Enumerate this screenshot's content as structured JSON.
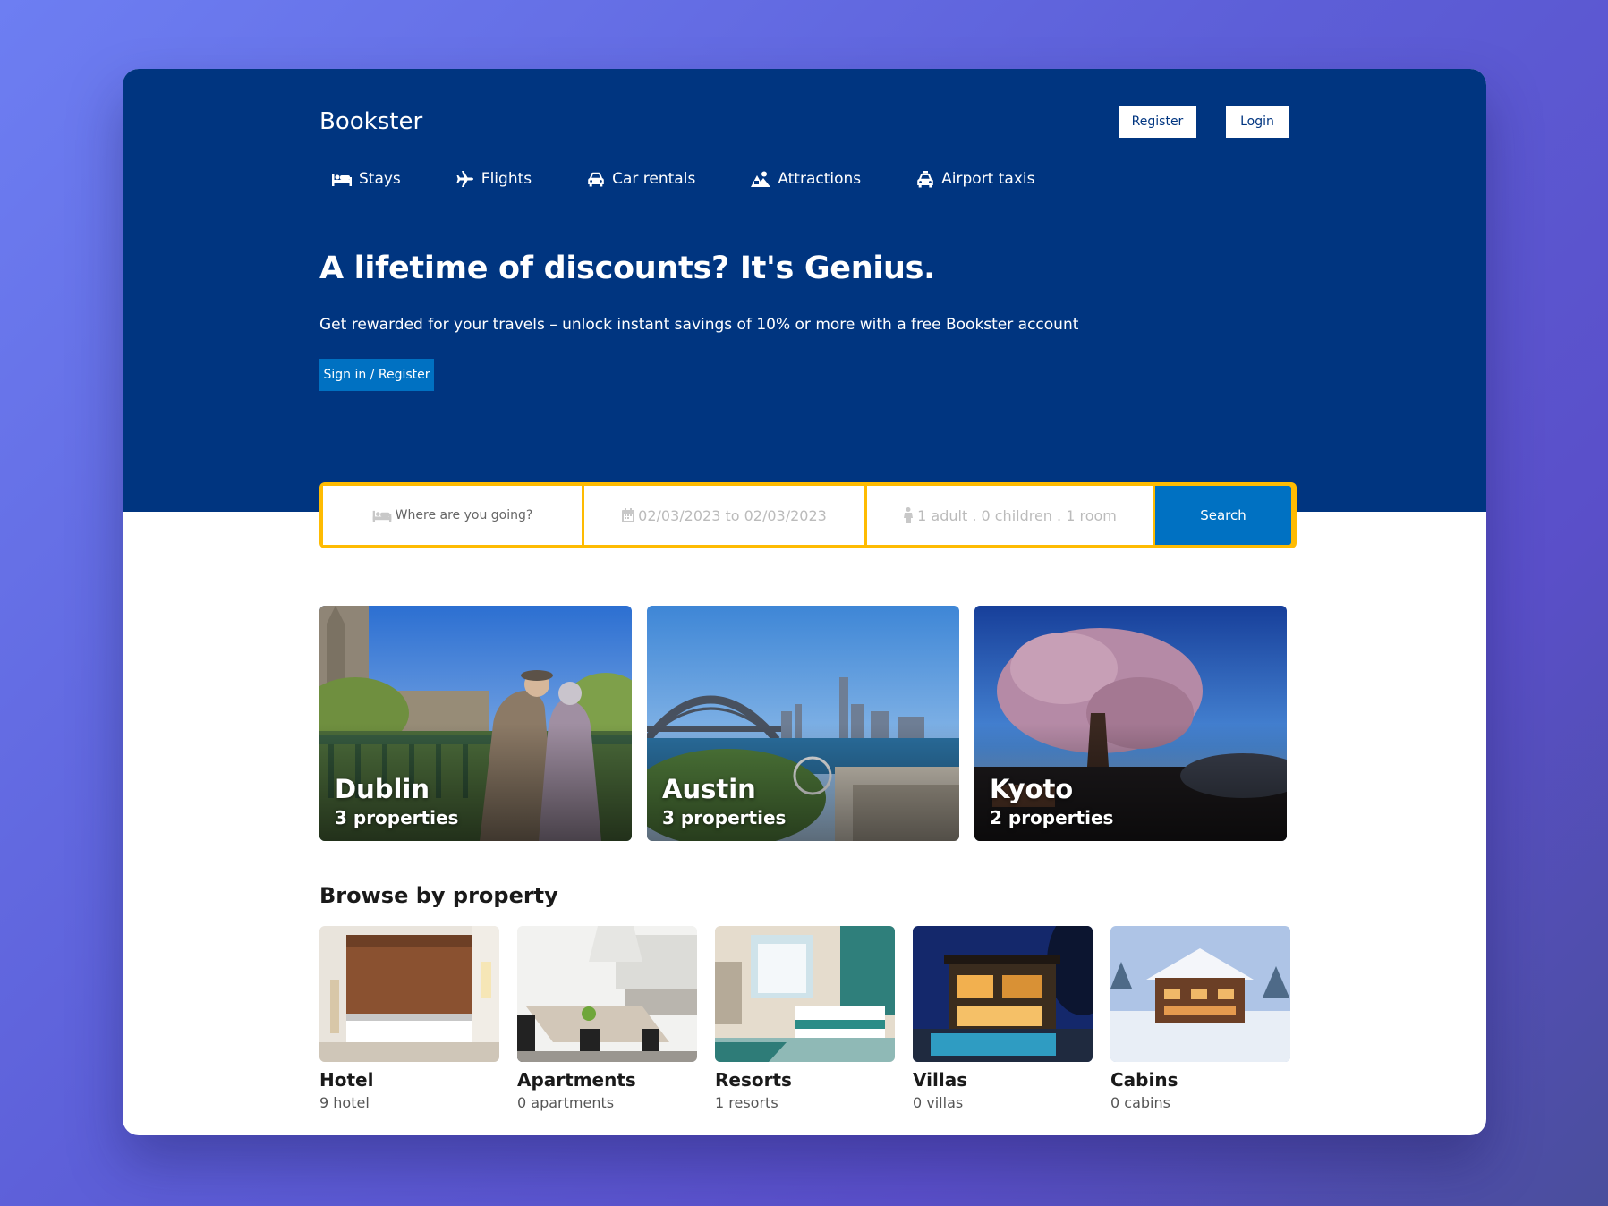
{
  "brand": "Bookster",
  "header": {
    "register_label": "Register",
    "login_label": "Login"
  },
  "nav": [
    {
      "label": "Stays",
      "icon": "bed-icon"
    },
    {
      "label": "Flights",
      "icon": "plane-icon"
    },
    {
      "label": "Car rentals",
      "icon": "car-icon"
    },
    {
      "label": "Attractions",
      "icon": "attractions-icon"
    },
    {
      "label": "Airport taxis",
      "icon": "taxi-icon"
    }
  ],
  "hero": {
    "headline": "A lifetime of discounts? It's Genius.",
    "subline": "Get rewarded for your travels – unlock instant savings of 10% or more with a free Bookster account",
    "cta_label": "Sign in / Register"
  },
  "search": {
    "destination_placeholder": "Where are you going?",
    "dates": "02/03/2023 to 02/03/2023",
    "guests": "1 adult . 0 children . 1 room",
    "button_label": "Search"
  },
  "cities": [
    {
      "name": "Dublin",
      "count": "3 properties"
    },
    {
      "name": "Austin",
      "count": "3 properties"
    },
    {
      "name": "Kyoto",
      "count": "2 properties"
    }
  ],
  "browse": {
    "title": "Browse by property",
    "items": [
      {
        "name": "Hotel",
        "count": "9 hotel"
      },
      {
        "name": "Apartments",
        "count": "0 apartments"
      },
      {
        "name": "Resorts",
        "count": "1 resorts"
      },
      {
        "name": "Villas",
        "count": "0 villas"
      },
      {
        "name": "Cabins",
        "count": "0 cabins"
      }
    ]
  },
  "colors": {
    "hero_bg": "#003580",
    "accent_blue": "#0071c2",
    "search_border": "#febb02"
  }
}
